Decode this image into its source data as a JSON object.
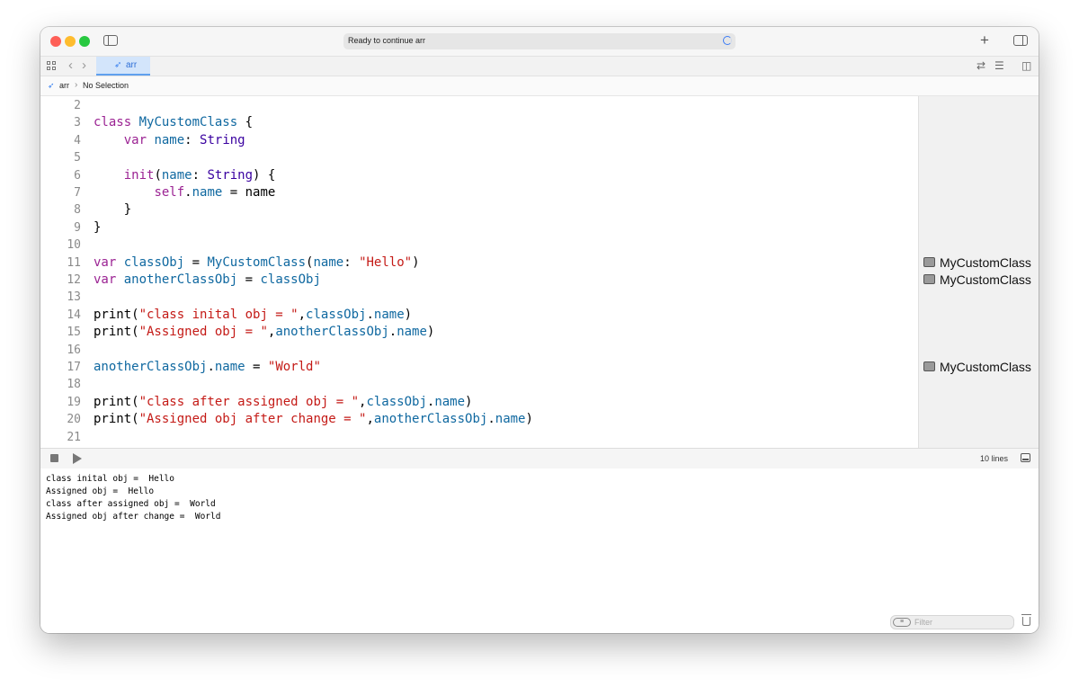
{
  "titlebar": {
    "status": "Ready to continue arr"
  },
  "tab": {
    "label": "arr"
  },
  "breadcrumb": {
    "file": "arr",
    "selection": "No Selection"
  },
  "editor": {
    "lines": [
      {
        "num": "2",
        "tokens": []
      },
      {
        "num": "3",
        "tokens": [
          {
            "t": "class",
            "c": "kw"
          },
          {
            "t": " "
          },
          {
            "t": "MyCustomClass",
            "c": "id"
          },
          {
            "t": " {"
          }
        ]
      },
      {
        "num": "4",
        "tokens": [
          {
            "t": "    "
          },
          {
            "t": "var",
            "c": "kw"
          },
          {
            "t": " "
          },
          {
            "t": "name",
            "c": "id"
          },
          {
            "t": ": "
          },
          {
            "t": "String",
            "c": "ty"
          }
        ]
      },
      {
        "num": "5",
        "tokens": []
      },
      {
        "num": "6",
        "tokens": [
          {
            "t": "    "
          },
          {
            "t": "init",
            "c": "kw"
          },
          {
            "t": "("
          },
          {
            "t": "name",
            "c": "id"
          },
          {
            "t": ": "
          },
          {
            "t": "String",
            "c": "ty"
          },
          {
            "t": ") {"
          }
        ]
      },
      {
        "num": "7",
        "tokens": [
          {
            "t": "        "
          },
          {
            "t": "self",
            "c": "kw"
          },
          {
            "t": "."
          },
          {
            "t": "name",
            "c": "id"
          },
          {
            "t": " = name"
          }
        ]
      },
      {
        "num": "8",
        "tokens": [
          {
            "t": "    }"
          }
        ]
      },
      {
        "num": "9",
        "tokens": [
          {
            "t": "}"
          }
        ]
      },
      {
        "num": "10",
        "tokens": []
      },
      {
        "num": "11",
        "tokens": [
          {
            "t": "var",
            "c": "kw"
          },
          {
            "t": " "
          },
          {
            "t": "classObj",
            "c": "id"
          },
          {
            "t": " = "
          },
          {
            "t": "MyCustomClass",
            "c": "id"
          },
          {
            "t": "("
          },
          {
            "t": "name",
            "c": "id"
          },
          {
            "t": ": "
          },
          {
            "t": "\"Hello\"",
            "c": "st"
          },
          {
            "t": ")"
          }
        ]
      },
      {
        "num": "12",
        "tokens": [
          {
            "t": "var",
            "c": "kw"
          },
          {
            "t": " "
          },
          {
            "t": "anotherClassObj",
            "c": "id"
          },
          {
            "t": " = "
          },
          {
            "t": "classObj",
            "c": "id"
          }
        ]
      },
      {
        "num": "13",
        "tokens": []
      },
      {
        "num": "14",
        "tokens": [
          {
            "t": "print("
          },
          {
            "t": "\"class inital obj = \"",
            "c": "st"
          },
          {
            "t": ","
          },
          {
            "t": "classObj",
            "c": "id"
          },
          {
            "t": "."
          },
          {
            "t": "name",
            "c": "id"
          },
          {
            "t": ")"
          }
        ]
      },
      {
        "num": "15",
        "tokens": [
          {
            "t": "print("
          },
          {
            "t": "\"Assigned obj = \"",
            "c": "st"
          },
          {
            "t": ","
          },
          {
            "t": "anotherClassObj",
            "c": "id"
          },
          {
            "t": "."
          },
          {
            "t": "name",
            "c": "id"
          },
          {
            "t": ")"
          }
        ]
      },
      {
        "num": "16",
        "tokens": []
      },
      {
        "num": "17",
        "tokens": [
          {
            "t": "anotherClassObj",
            "c": "id"
          },
          {
            "t": "."
          },
          {
            "t": "name",
            "c": "id"
          },
          {
            "t": " = "
          },
          {
            "t": "\"World\"",
            "c": "st"
          }
        ]
      },
      {
        "num": "18",
        "tokens": []
      },
      {
        "num": "19",
        "tokens": [
          {
            "t": "print("
          },
          {
            "t": "\"class after assigned obj = \"",
            "c": "st"
          },
          {
            "t": ","
          },
          {
            "t": "classObj",
            "c": "id"
          },
          {
            "t": "."
          },
          {
            "t": "name",
            "c": "id"
          },
          {
            "t": ")"
          }
        ]
      },
      {
        "num": "20",
        "tokens": [
          {
            "t": "print("
          },
          {
            "t": "\"Assigned obj after change = \"",
            "c": "st"
          },
          {
            "t": ","
          },
          {
            "t": "anotherClassObj",
            "c": "id"
          },
          {
            "t": "."
          },
          {
            "t": "name",
            "c": "id"
          },
          {
            "t": ")"
          }
        ]
      },
      {
        "num": "21",
        "tokens": []
      }
    ]
  },
  "results": [
    {
      "line": "11",
      "text": "MyCustomClass"
    },
    {
      "line": "12",
      "text": "MyCustomClass"
    },
    {
      "line": "17",
      "text": "MyCustomClass"
    }
  ],
  "debug": {
    "line_count": "10 lines"
  },
  "console": {
    "lines": [
      "class inital obj =  Hello",
      "Assigned obj =  Hello",
      "class after assigned obj =  World",
      "Assigned obj after change =  World"
    ]
  },
  "filter": {
    "placeholder": "Filter"
  },
  "colors": {
    "keyword": "#9b2393",
    "type": "#3900a0",
    "identifier": "#0f68a0",
    "string": "#c41a16",
    "accent": "#3b82f0"
  },
  "icons": [
    "close-light",
    "minimize-light",
    "maximize-light",
    "sidebar-toggle-icon",
    "spinner-icon",
    "plus-icon",
    "inspector-toggle-icon",
    "grid-icon",
    "chevron-left-icon",
    "chevron-right-icon",
    "swift-icon",
    "refresh-icon",
    "minimap-icon",
    "editor-layout-icon",
    "stop-icon",
    "play-icon",
    "console-toggle-icon",
    "filter-icon",
    "trash-icon"
  ]
}
